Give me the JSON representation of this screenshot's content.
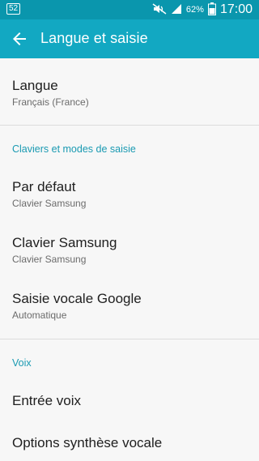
{
  "status_bar": {
    "left_badge": "52",
    "battery_percent": "62%",
    "time": "17:00",
    "icons": [
      "mute-icon",
      "signal-icon",
      "battery-icon"
    ]
  },
  "app_bar": {
    "title": "Langue et saisie",
    "color": "#12a8c2"
  },
  "items": {
    "langue": {
      "title": "Langue",
      "subtitle": "Français (France)"
    },
    "section_keyboards": "Claviers et modes de saisie",
    "par_defaut": {
      "title": "Par défaut",
      "subtitle": "Clavier Samsung"
    },
    "clavier_samsung": {
      "title": "Clavier Samsung",
      "subtitle": "Clavier Samsung"
    },
    "saisie_vocale": {
      "title": "Saisie vocale Google",
      "subtitle": "Automatique"
    },
    "section_voix": "Voix",
    "entree_voix": {
      "title": "Entrée voix"
    },
    "options_synthese": {
      "title": "Options synthèse vocale"
    }
  },
  "colors": {
    "accent": "#1a9ab2",
    "status_bar": "#0a96ad",
    "background": "#f7f7f7"
  }
}
